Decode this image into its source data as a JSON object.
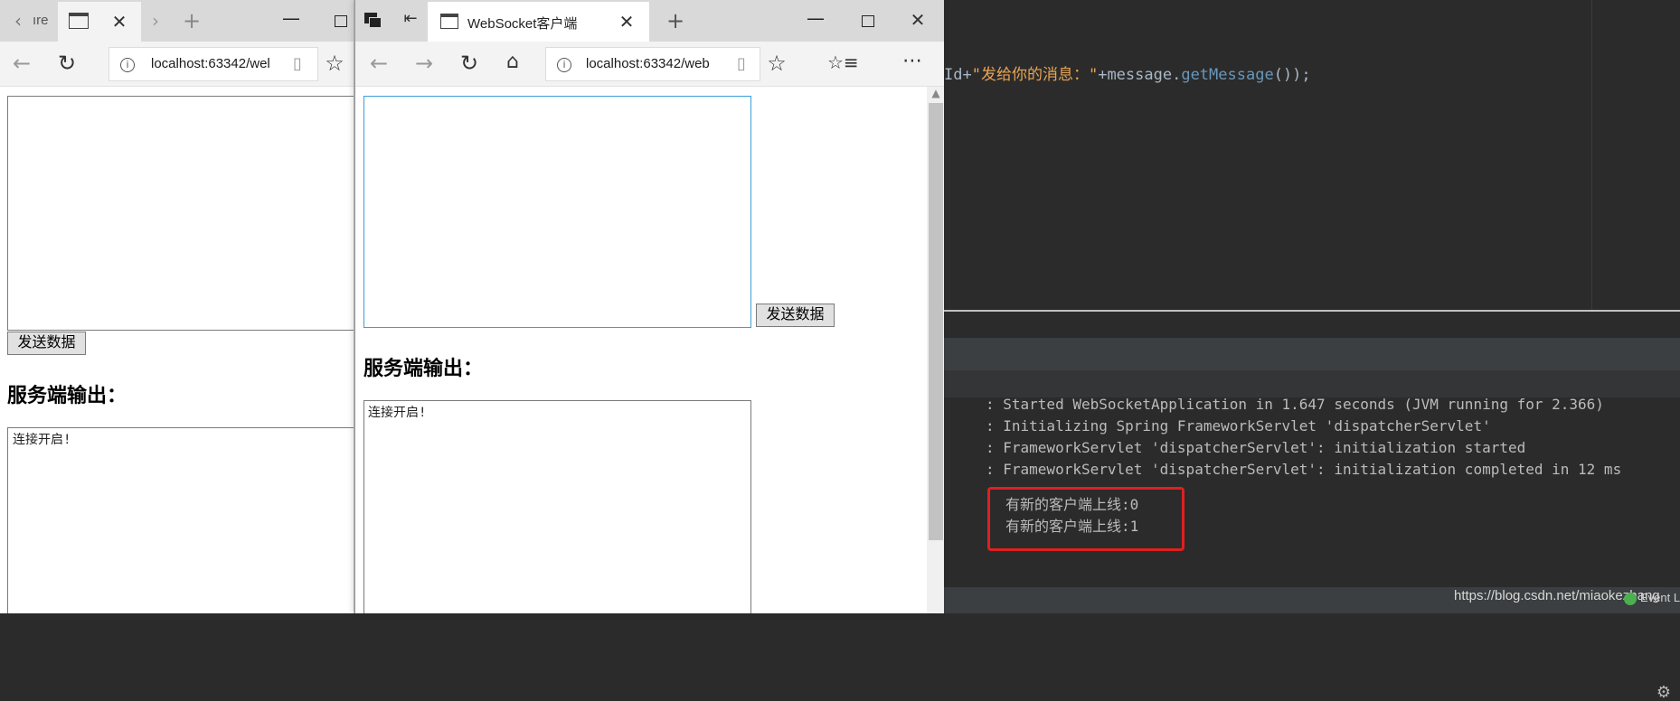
{
  "ide": {
    "code_line": {
      "prefix": "Id+",
      "string": "\"发给你的消息：\"",
      "middle": "+message.",
      "method": "getMessage",
      "suffix": "());"
    },
    "console_lines": [
      ": Started WebSocketApplication in 1.647 seconds (JVM running for 2.366)",
      ": Initializing Spring FrameworkServlet 'dispatcherServlet'",
      ": FrameworkServlet 'dispatcherServlet': initialization started",
      ": FrameworkServlet 'dispatcherServlet': initialization completed in 12 ms"
    ],
    "highlighted_lines": [
      "有新的客户端上线:0",
      "有新的客户端上线:1"
    ],
    "watermark": "https://blog.csdn.net/miaokezhang",
    "event_label": "Event L",
    "colors": {
      "highlight_box": "#e01f1f",
      "string": "#e8a454",
      "method": "#6897bb"
    }
  },
  "browser_back": {
    "tab_title_partial": "ıre",
    "address": "localhost:63342/wel",
    "send_button": "发送数据",
    "output_heading": "服务端输出：",
    "output_text": "连接开启!"
  },
  "browser_front": {
    "tab_title": "WebSocket客户端",
    "address": "localhost:63342/web",
    "send_button": "发送数据",
    "output_heading": "服务端输出：",
    "output_text": "连接开启!"
  }
}
